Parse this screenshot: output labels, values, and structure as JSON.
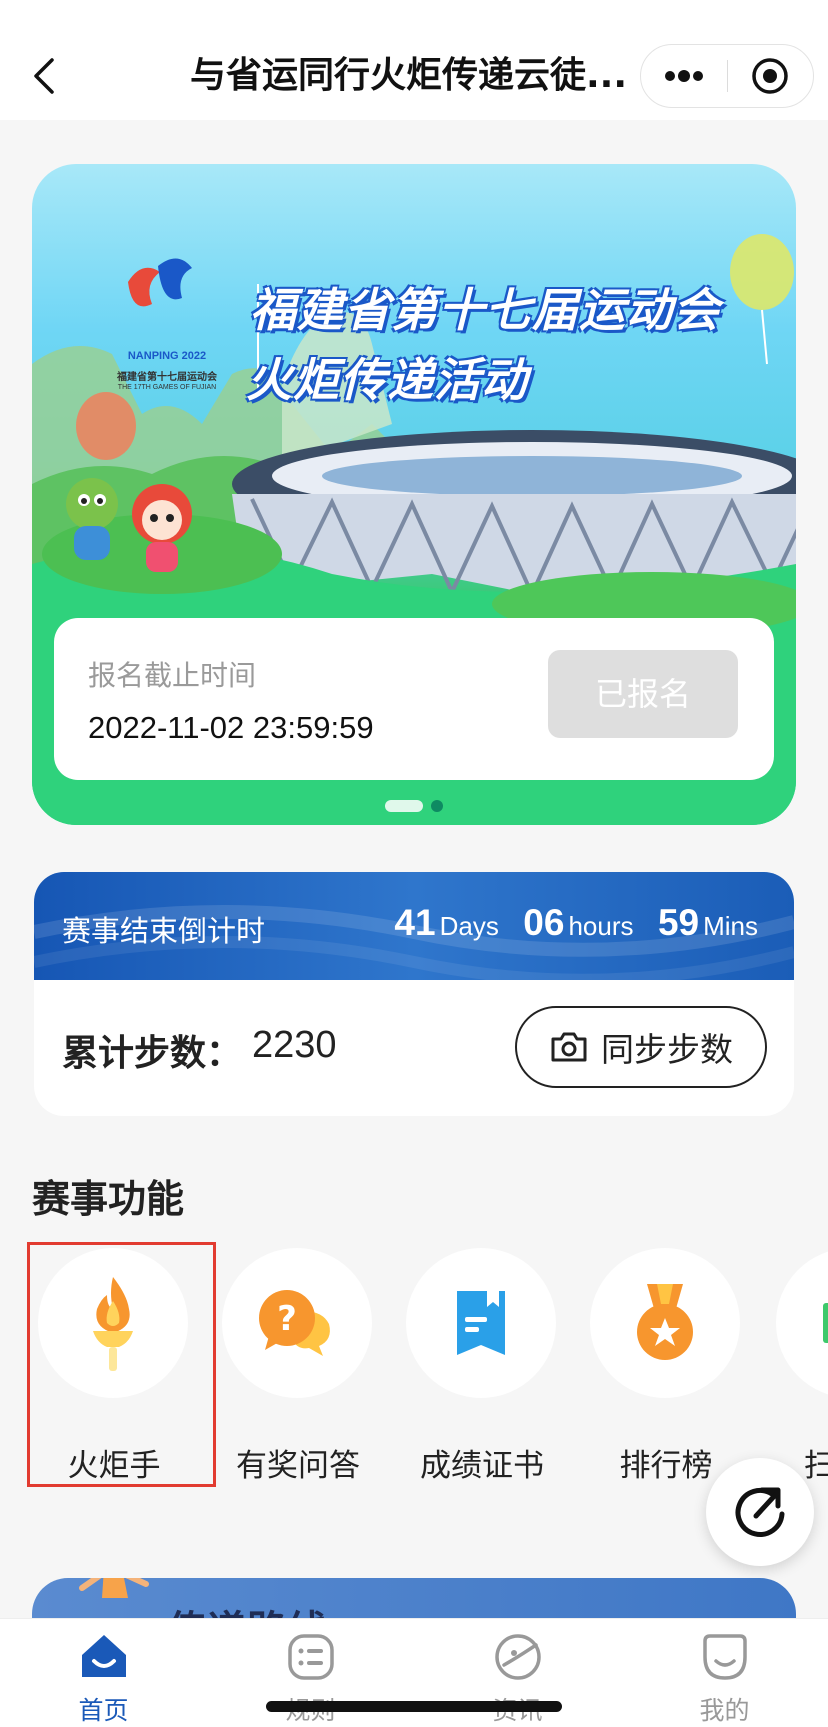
{
  "header": {
    "title": "与省运同行火炬传递云徒...",
    "back_icon": "chevron-left-icon",
    "more_icon": "more-dots-icon",
    "close_icon": "target-circle-icon"
  },
  "banner": {
    "logo_year": "NANPING 2022",
    "logo_name_cn": "福建省第十七届运动会",
    "logo_name_en": "THE 17TH GAMES OF FUJIAN",
    "headline_1": "福建省第十七届运动会",
    "headline_2": "火炬传递活动",
    "registration": {
      "label": "报名截止时间",
      "deadline": "2022-11-02 23:59:59",
      "button_label": "已报名"
    },
    "slide_count": 2,
    "active_slide": 1
  },
  "countdown": {
    "title": "赛事结束倒计时",
    "days": "41",
    "days_unit": "Days",
    "hours": "06",
    "hours_unit": "hours",
    "mins": "59",
    "mins_unit": "Mins"
  },
  "steps": {
    "label": "累计步数：",
    "value": "2230",
    "sync_label": "同步步数",
    "sync_icon": "camera-icon"
  },
  "features": {
    "title": "赛事功能",
    "items": [
      {
        "label": "火炬手",
        "icon": "torch-icon"
      },
      {
        "label": "有奖问答",
        "icon": "question-bubble-icon"
      },
      {
        "label": "成绩证书",
        "icon": "certificate-icon"
      },
      {
        "label": "排行榜",
        "icon": "medal-icon"
      },
      {
        "label": "扫",
        "icon": "scan-icon"
      }
    ]
  },
  "route": {
    "title": "传递路线"
  },
  "float_icon": "refresh-arrow-icon",
  "tabs": [
    {
      "label": "首页",
      "icon": "home-icon",
      "active": true
    },
    {
      "label": "规则",
      "icon": "rules-list-icon",
      "active": false
    },
    {
      "label": "资讯",
      "icon": "news-icon",
      "active": false
    },
    {
      "label": "我的",
      "icon": "profile-icon",
      "active": false
    }
  ],
  "colors": {
    "accent": "#1a59b8",
    "countdown_bg": "#1f63bd",
    "highlight_border": "#e23b30",
    "orange": "#f7962e"
  }
}
